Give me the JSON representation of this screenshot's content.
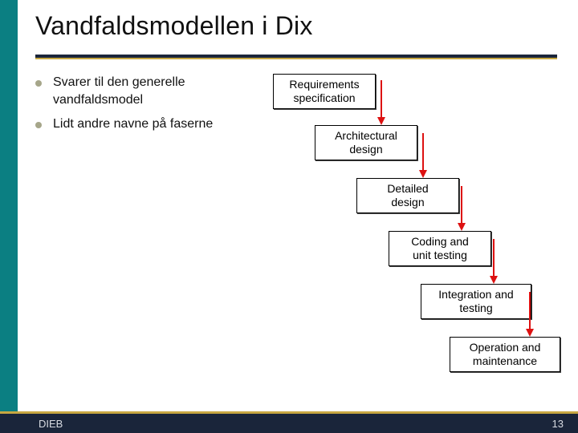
{
  "title": "Vandfaldsmodellen i Dix",
  "bullets": [
    "Svarer til den generelle vandfaldsmodel",
    "Lidt andre navne på faserne"
  ],
  "boxes": [
    {
      "line1": "Requirements",
      "line2": "specification"
    },
    {
      "line1": "Architectural",
      "line2": "design"
    },
    {
      "line1": "Detailed",
      "line2": "design"
    },
    {
      "line1": "Coding and",
      "line2": "unit testing"
    },
    {
      "line1": "Integration and",
      "line2": "testing"
    },
    {
      "line1": "Operation and",
      "line2": "maintenance"
    }
  ],
  "footer": {
    "left": "DIEB",
    "right": "13"
  },
  "colors": {
    "arrow": "#d11"
  }
}
